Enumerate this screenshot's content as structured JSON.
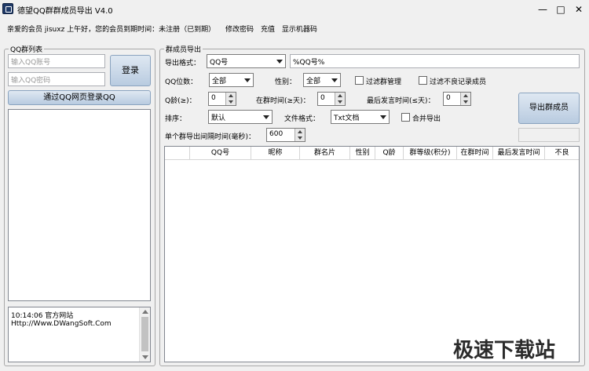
{
  "window": {
    "title": "德望QQ群群成员导出 V4.0",
    "controls": {
      "minimize": "—",
      "maximize": "□",
      "close": "✕"
    }
  },
  "menubar": {
    "greeting": "亲爱的会员 jisuxz 上午好，您的会员到期时间：未注册（已到期）",
    "items": [
      "修改密码",
      "充值",
      "显示机器码"
    ]
  },
  "left": {
    "group_title": "QQ群列表",
    "account_placeholder": "输入QQ账号",
    "password_placeholder": "输入QQ密码",
    "login_button": "登录",
    "web_login_button": "通过QQ网页登录QQ",
    "log": [
      "10:14:06 官方网站",
      "Http://Www.DWangSoft.Com"
    ]
  },
  "right": {
    "group_title": "群成员导出",
    "export_format_label": "导出格式：",
    "export_format_value": "QQ号",
    "template_value": "%QQ号%",
    "qq_digits_label": "QQ位数：",
    "qq_digits_value": "全部",
    "gender_label": "性别：",
    "gender_value": "全部",
    "filter_admin_label": "过滤群管理",
    "filter_bad_label": "过滤不良记录成员",
    "age_label": "Q龄(≥)：",
    "age_value": "0",
    "in_group_label": "在群时间(≥天)：",
    "in_group_value": "0",
    "last_speak_label": "最后发言时间(≤天)：",
    "last_speak_value": "0",
    "sort_label": "排序：",
    "sort_value": "默认",
    "file_format_label": "文件格式：",
    "file_format_value": "Txt文档",
    "merge_label": "合并导出",
    "interval_label": "单个群导出间隔时间(毫秒)：",
    "interval_value": "600",
    "export_button": "导出群成员",
    "table_headers": [
      "",
      "QQ号",
      "昵称",
      "群名片",
      "性别",
      "Q龄",
      "群等级(积分)",
      "在群时间",
      "最后发言时间",
      "不良"
    ]
  },
  "watermark": "极速下载站"
}
